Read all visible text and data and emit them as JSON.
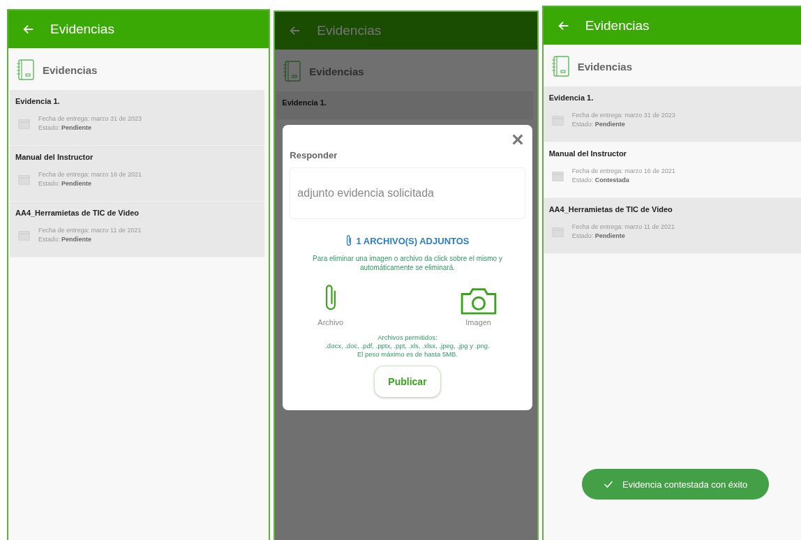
{
  "screens": [
    {
      "kind": "list",
      "title": "Evidencias",
      "heading": "Evidencias",
      "items": [
        {
          "title": "Evidencia 1.",
          "date_label": "Fecha de entrega:",
          "date": "marzo 31 de 2023",
          "status_label": "Estado:",
          "status": "Pendiente",
          "answered": false
        },
        {
          "title": "Manual del Instructor",
          "date_label": "Fecha de entrega:",
          "date": "marzo 16 de 2021",
          "status_label": "Estado:",
          "status": "Pendiente",
          "answered": false
        },
        {
          "title": "AA4_Herramietas de TIC de Video",
          "date_label": "Fecha de entrega:",
          "date": "marzo 11 de 2021",
          "status_label": "Estado:",
          "status": "Pendiente",
          "answered": false
        }
      ]
    },
    {
      "kind": "dialog",
      "title": "Evidencias",
      "heading": "Evidencias",
      "items": [
        {
          "title": "Evidencia 1."
        }
      ],
      "dialog": {
        "label": "Responder",
        "value": "adjunto evidencia solicitada",
        "attachments": "1 ARCHIVO(S) ADJUNTOS",
        "hint": "Para eliminar una imagen o archivo da click sobre el mismo y automáticamente se eliminará.",
        "options": [
          {
            "kind": "file",
            "label": "Archivo"
          },
          {
            "kind": "camera",
            "label": "Imagen"
          }
        ],
        "allowed": [
          "Archivos permitidos:",
          ".docx, .doc, .pdf, .pptx, .ppt, .xls, .xlsx, .jpeg, .jpg y .png.",
          "El peso máximo es de hasta 5MB."
        ],
        "button": "Publicar"
      }
    },
    {
      "kind": "list",
      "title": "Evidencias",
      "heading": "Evidencias",
      "items": [
        {
          "title": "Evidencia 1.",
          "date_label": "Fecha de entrega:",
          "date": "marzo 31 de 2023",
          "status_label": "Estado:",
          "status": "Pendiente",
          "answered": false
        },
        {
          "title": "Manual del Instructor",
          "date_label": "Fecha de entrega:",
          "date": "marzo 16 de 2021",
          "status_label": "Estado:",
          "status": "Contestada",
          "answered": true
        },
        {
          "title": "AA4_Herramietas de TIC de Video",
          "date_label": "Fecha de entrega:",
          "date": "marzo 11 de 2021",
          "status_label": "Estado:",
          "status": "Pendiente",
          "answered": false
        }
      ],
      "toast": "Evidencia contestada con éxito"
    }
  ]
}
